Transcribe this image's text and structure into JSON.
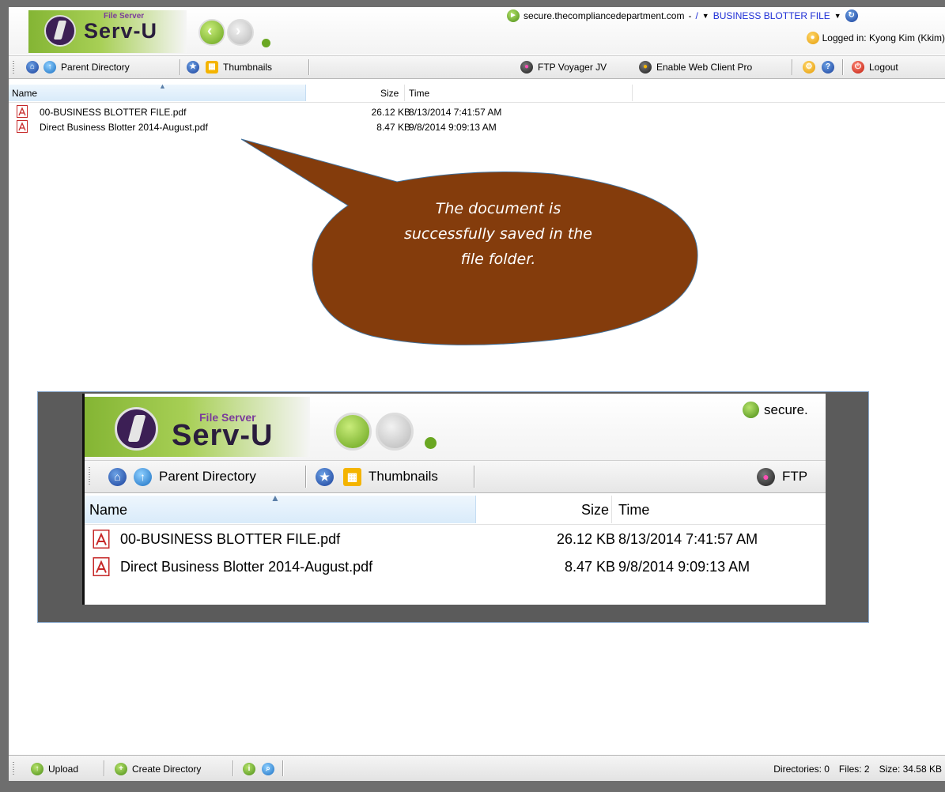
{
  "header": {
    "logo_small": "File Server",
    "logo_big": "Serv-U",
    "host": "secure.thecompliancedepartment.com",
    "host_separator": "-",
    "path_root": "/",
    "current_folder": "BUSINESS BLOTTER FILE",
    "login_text": "Logged in: Kyong Kim (Kkim)"
  },
  "toolbar": {
    "parent_directory": "Parent Directory",
    "thumbnails": "Thumbnails",
    "ftp_voyager": "FTP Voyager JV",
    "enable_web_client_pro": "Enable Web Client Pro",
    "logout": "Logout"
  },
  "file_list": {
    "columns": {
      "name": "Name",
      "size": "Size",
      "time": "Time"
    },
    "rows": [
      {
        "name": "00-BUSINESS BLOTTER FILE.pdf",
        "size": "26.12 KB",
        "time": "8/13/2014 7:41:57 AM"
      },
      {
        "name": "Direct Business Blotter 2014-August.pdf",
        "size": "8.47 KB",
        "time": "9/8/2014 9:09:13 AM"
      }
    ]
  },
  "callout": {
    "line1": "The document is",
    "line2": "successfully saved in the",
    "line3": "file folder.",
    "fill_color": "#843c0c"
  },
  "inset": {
    "host_partial": "secure.",
    "ftp_partial": "FTP"
  },
  "statusbar": {
    "upload": "Upload",
    "create_directory": "Create Directory",
    "directories": "Directories: 0",
    "files": "Files: 2",
    "size": "Size: 34.58 KB"
  },
  "colors": {
    "link_blue": "#1f2fd6",
    "brand_green": "#84b534",
    "frame_gray": "#6e6e6e"
  }
}
